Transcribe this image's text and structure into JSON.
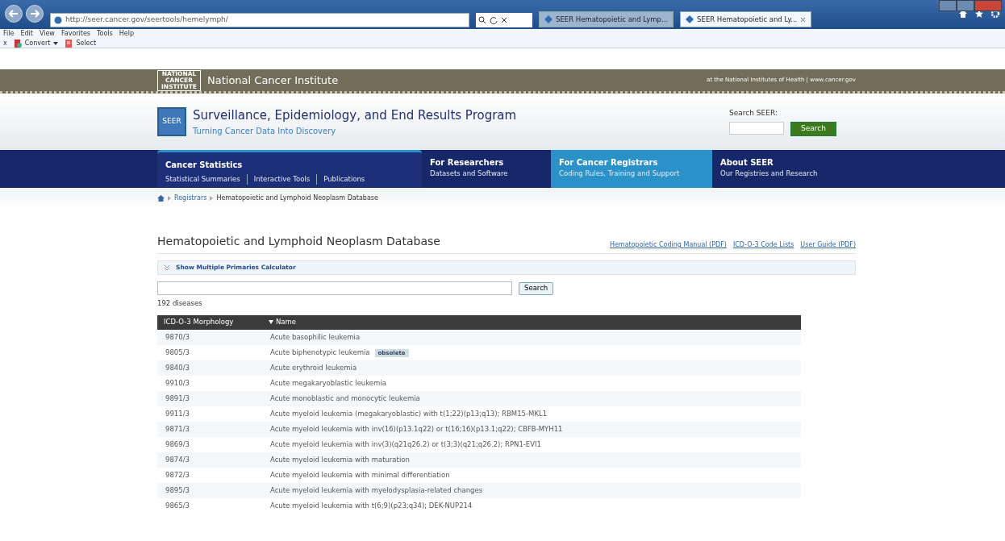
{
  "browser": {
    "address": "http://seer.cancer.gov/seertools/hemelymph/",
    "tabs": [
      {
        "label": "SEER Hematopoietic and Lymp...",
        "selected": false
      },
      {
        "label": "SEER Hematopoietic and Ly...",
        "selected": true
      }
    ],
    "menu": [
      "File",
      "Edit",
      "View",
      "Favorites",
      "Tools",
      "Help"
    ],
    "commands": [
      {
        "kind": "close",
        "label": "x"
      },
      {
        "kind": "convert",
        "label": "Convert"
      },
      {
        "kind": "select",
        "label": "Select"
      }
    ]
  },
  "agency_bar": {
    "name": "National Cancer Institute",
    "logo": "NATIONAL CANCER INSTITUTE",
    "tagline": "at the National Institutes of Health | www.cancer.gov"
  },
  "header": {
    "badge": "SEER",
    "title": "Surveillance, Epidemiology, and End Results Program",
    "subtitle": "Turning Cancer Data Into Discovery",
    "search_label": "Search SEER:",
    "search_button": "Search"
  },
  "nav": [
    {
      "title": "Cancer Statistics",
      "links": [
        "Statistical Summaries",
        "Interactive Tools",
        "Publications"
      ],
      "selected": false,
      "highlighted": true
    },
    {
      "title": "For Researchers",
      "subtitle": "Datasets and Software",
      "selected": false,
      "highlighted": false
    },
    {
      "title": "For Cancer Registrars",
      "subtitle": "Coding Rules, Training and Support",
      "selected": true,
      "highlighted": false
    },
    {
      "title": "About SEER",
      "subtitle": "Our Registries and Research",
      "selected": false,
      "highlighted": false
    }
  ],
  "breadcrumb": [
    "Registrars",
    "Hematopoietic and Lymphoid Neoplasm Database"
  ],
  "page_title": "Hematopoietic and Lymphoid Neoplasm Database",
  "doc_links": [
    "Hematopoietic Coding Manual (PDF)",
    "ICD-O-3 Code Lists",
    "User Guide (PDF)"
  ],
  "calculator_toggle": {
    "label": "Show Multiple Primaries Calculator",
    "expanded": false
  },
  "search_button": "Search",
  "count": "192 diseases",
  "table": {
    "columns": [
      {
        "label": "ICD-O-3 Morphology",
        "sorted": false
      },
      {
        "label": "Name",
        "sorted": true
      }
    ],
    "rows": [
      {
        "code": "9870/3",
        "name": "Acute basophilic leukemia"
      },
      {
        "code": "9805/3",
        "name": "Acute biphenotypic leukemia",
        "tag": "obsolete"
      },
      {
        "code": "9840/3",
        "name": "Acute erythroid leukemia"
      },
      {
        "code": "9910/3",
        "name": "Acute megakaryoblastic leukemia"
      },
      {
        "code": "9891/3",
        "name": "Acute monoblastic and monocytic leukemia"
      },
      {
        "code": "9911/3",
        "name": "Acute myeloid leukemia (megakaryoblastic) with t(1;22)(p13;q13); RBM15-MKL1"
      },
      {
        "code": "9871/3",
        "name": "Acute myeloid leukemia with inv(16)(p13.1q22) or t(16;16)(p13.1;q22); CBFB-MYH11"
      },
      {
        "code": "9869/3",
        "name": "Acute myeloid leukemia with inv(3)(q21q26.2) or t(3;3)(q21;q26.2); RPN1-EVI1"
      },
      {
        "code": "9874/3",
        "name": "Acute myeloid leukemia with maturation"
      },
      {
        "code": "9872/3",
        "name": "Acute myeloid leukemia with minimal differentiation"
      },
      {
        "code": "9895/3",
        "name": "Acute myeloid leukemia with myelodysplasia-related changes"
      },
      {
        "code": "9865/3",
        "name": "Acute myeloid leukemia with t(6;9)(p23;q34); DEK-NUP214"
      }
    ]
  }
}
